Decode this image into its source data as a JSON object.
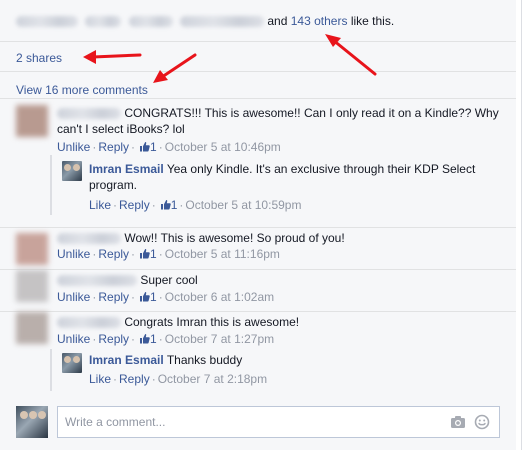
{
  "likes": {
    "and_text": "and",
    "others_link": "143 others",
    "suffix": "like this."
  },
  "shares": {
    "label": "2 shares"
  },
  "view_more": {
    "label": "View 16 more comments"
  },
  "actions": {
    "unlike": "Unlike",
    "like": "Like",
    "reply": "Reply",
    "separator": "·"
  },
  "comments": [
    {
      "text": "CONGRATS!!! This is awesome!! Can I only read it on a Kindle?? Why can't I select iBooks? lol",
      "likes": "1",
      "timestamp": "October 5 at 10:46pm",
      "reply": {
        "author": "Imran Esmail",
        "text": "Yea only Kindle. It's an exclusive through their KDP Select program.",
        "likes": "1",
        "timestamp": "October 5 at 10:59pm"
      }
    },
    {
      "text": "Wow!! This is awesome! So proud of you!",
      "likes": "1",
      "timestamp": "October 5 at 11:16pm"
    },
    {
      "text": "Super cool",
      "likes": "1",
      "timestamp": "October 6 at 1:02am"
    },
    {
      "text": "Congrats Imran this is awesome!",
      "likes": "1",
      "timestamp": "October 7 at 1:27pm",
      "reply": {
        "author": "Imran Esmail",
        "text": "Thanks buddy",
        "timestamp": "October 7 at 2:18pm"
      }
    }
  ],
  "composer": {
    "placeholder": "Write a comment..."
  },
  "colors": {
    "link": "#3b5998",
    "annotation_arrow": "#e8141b",
    "meta": "#9197a3",
    "panel": "#f6f7f9"
  },
  "icons": [
    "thumbs-up-icon",
    "camera-icon",
    "emoji-icon",
    "arrow-annotation"
  ]
}
